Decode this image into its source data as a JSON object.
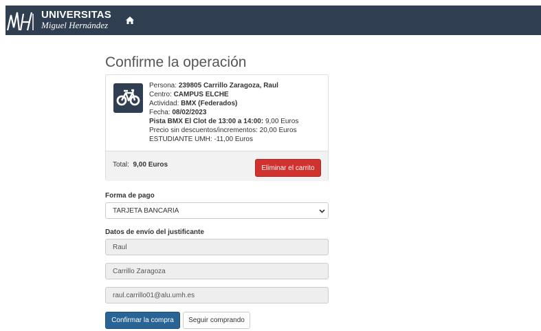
{
  "header": {
    "logo_title": "UNIVERSITAS",
    "logo_subtitle": "Miguel Hernández",
    "logo_icon": "umh-logo",
    "home_icon": "home-icon",
    "bar_color": "#2f3e50"
  },
  "page": {
    "title": "Confirme la operación"
  },
  "cart": {
    "activity_icon": "bicycle-icon",
    "persona_label": "Persona:",
    "persona_value": "239805 Carrillo Zaragoza, Raul",
    "centro_label": "Centro:",
    "centro_value": "CAMPUS ELCHE",
    "actividad_label": "Actividad:",
    "actividad_value": "BMX (Federados)",
    "fecha_label": "Fecha:",
    "fecha_value": "08/02/2023",
    "pista_label": "Pista BMX El Clot de 13:00 a 14:00:",
    "pista_value": "9,00 Euros",
    "precio_line": "Precio sin descuentos/incrementos: 20,00 Euros",
    "descuento_line": "ESTUDIANTE UMH: -11,00 Euros",
    "total_label": "Total:",
    "total_value": "9,00 Euros",
    "delete_button": "Eliminar el carrito"
  },
  "payment": {
    "label": "Forma de pago",
    "selected": "TARJETA BANCARIA"
  },
  "shipping": {
    "label": "Datos de envío del justificante",
    "nombre": "Raul",
    "apellidos": "Carrillo Zaragoza",
    "email": "raul.carrillo01@alu.umh.es"
  },
  "actions": {
    "confirm_button": "Confirmar la compra",
    "continue_button": "Seguir comprando"
  },
  "colors": {
    "primary": "#2a6496",
    "danger": "#d2322d"
  }
}
